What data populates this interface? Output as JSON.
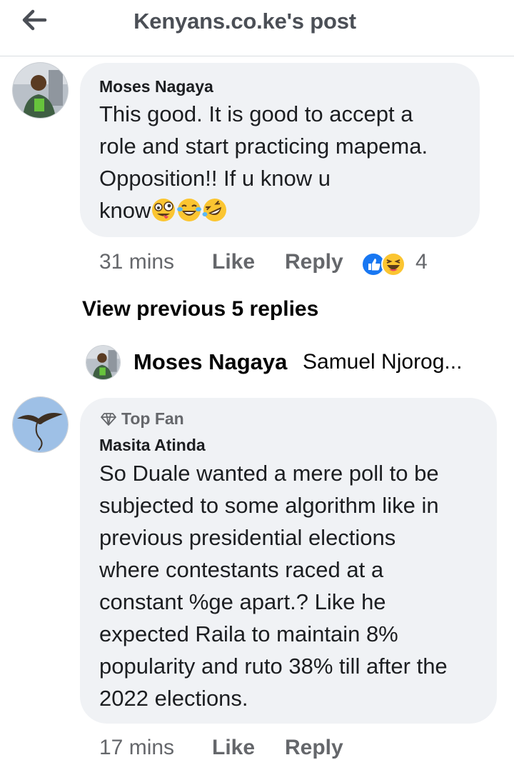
{
  "header": {
    "title": "Kenyans.co.ke's post",
    "back_icon": "arrow-left-icon"
  },
  "comment1": {
    "author": "Moses Nagaya",
    "lines": [
      "This good. It is good to accept a",
      "role and start practicing mapema.",
      "Opposition!! If u know u",
      "know"
    ],
    "emojis": [
      "zany-face-icon",
      "tears-of-joy-icon",
      "rolling-laughing-icon"
    ],
    "time": "31 mins",
    "like_label": "Like",
    "reply_label": "Reply",
    "reaction_icons": [
      "like-reaction-icon",
      "haha-reaction-icon"
    ],
    "reaction_count": "4"
  },
  "view_previous": "View previous 5 replies",
  "reply_preview": {
    "author": "Moses Nagaya",
    "text": "Samuel Njorog..."
  },
  "comment2": {
    "badge": "Top Fan",
    "badge_icon": "diamond-icon",
    "author": "Masita Atinda",
    "lines": [
      "So Duale wanted a mere poll to be",
      "subjected to some algorithm like in",
      "previous presidential elections",
      "where contestants raced at a",
      "constant %ge apart.? Like he",
      "expected Raila to maintain 8%",
      "popularity and ruto 38% till after the",
      "2022 elections."
    ],
    "time": "17 mins",
    "like_label": "Like",
    "reply_label": "Reply"
  },
  "colors": {
    "bubble": "#f0f2f5",
    "meta": "#65676b",
    "like_blue": "#1877f2"
  }
}
